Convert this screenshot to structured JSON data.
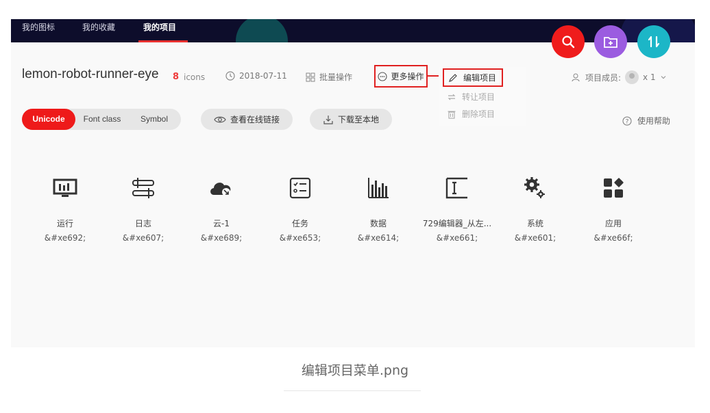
{
  "nav": {
    "items": [
      {
        "label": "我的图标"
      },
      {
        "label": "我的收藏"
      },
      {
        "label": "我的项目"
      }
    ]
  },
  "fabs": {
    "search_icon": "search-icon",
    "folder_icon": "add-folder-icon",
    "sort_icon": "sort-icon"
  },
  "project": {
    "title": "lemon-robot-runner-eye",
    "icon_count": "8",
    "icon_unit": "icons",
    "date": "2018-07-11",
    "batch_label": "批量操作",
    "more_label": "更多操作",
    "members_label": "项目成员:",
    "members_count": "x 1"
  },
  "dropdown": {
    "edit": "编辑项目",
    "transfer": "转让项目",
    "delete": "删除项目"
  },
  "tabs": {
    "unicode": "Unicode",
    "fontclass": "Font class",
    "symbol": "Symbol"
  },
  "actions": {
    "view_link": "查看在线链接",
    "download": "下载至本地",
    "help": "使用帮助"
  },
  "icons": [
    {
      "name": "运行",
      "code": "&#xe692;",
      "icon": "monitor-icon"
    },
    {
      "name": "日志",
      "code": "&#xe607;",
      "icon": "log-icon"
    },
    {
      "name": "云-1",
      "code": "&#xe689;",
      "icon": "cloud-icon"
    },
    {
      "name": "任务",
      "code": "&#xe653;",
      "icon": "task-icon"
    },
    {
      "name": "数据",
      "code": "&#xe614;",
      "icon": "data-icon"
    },
    {
      "name": "729编辑器_从左...",
      "code": "&#xe661;",
      "icon": "editor-icon"
    },
    {
      "name": "系统",
      "code": "&#xe601;",
      "icon": "gear-icon"
    },
    {
      "name": "应用",
      "code": "&#xe66f;",
      "icon": "apps-icon"
    }
  ],
  "caption": "编辑项目菜单.png",
  "colors": {
    "accent_red": "#ee1a1a",
    "nav_bg": "#0d0d2b",
    "fab_purple": "#9b5ce0",
    "fab_teal": "#1cb6c7"
  }
}
